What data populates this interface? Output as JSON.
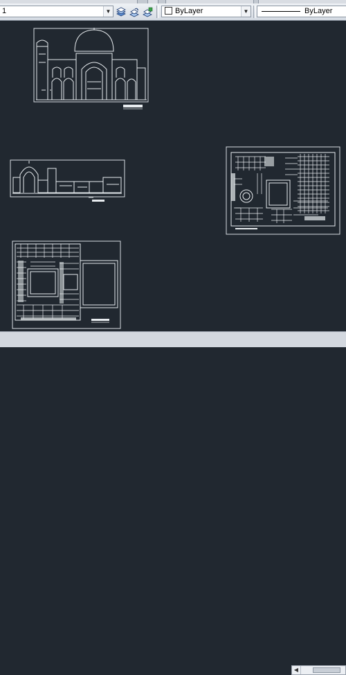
{
  "toolbar": {
    "workspace_value": "1",
    "layer_buttons": [
      "layer-states-icon",
      "layer-previous-icon",
      "make-current-icon"
    ],
    "color_value": "ByLayer",
    "linetype_value": "ByLayer"
  },
  "drawings": [
    {
      "name": "elevation-drawing",
      "kind": "facade"
    },
    {
      "name": "section-drawing",
      "kind": "section"
    },
    {
      "name": "floor-plan-right",
      "kind": "plan"
    },
    {
      "name": "floor-plan-bottom",
      "kind": "plan"
    }
  ],
  "colors": {
    "canvas": "#212830",
    "linework": "#e8ecef",
    "toolbar": "#dde2e8"
  }
}
